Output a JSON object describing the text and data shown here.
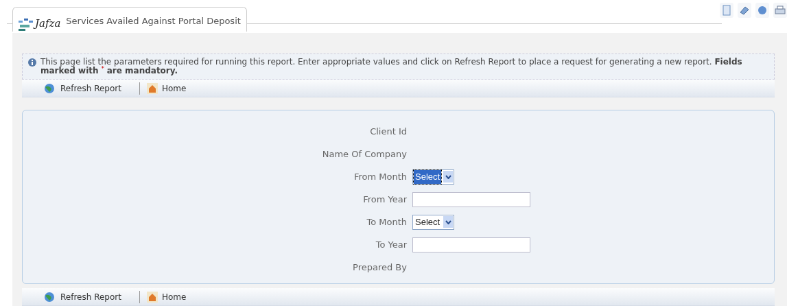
{
  "header": {
    "logo_text": "Jafza",
    "title": "Services Availed Against Portal Deposit"
  },
  "info": {
    "text": "This page list the parameters required for running this report. Enter appropriate values and click on Refresh Report to place a request for generating a new report. **Fields marked with** $^{*}$ **are mandatory.**"
  },
  "toolbar_top": [
    {
      "label": "Refresh Report",
      "kind": "refresh"
    },
    {
      "label": "Home",
      "kind": "home"
    }
  ],
  "form_fields": [
    {
      "label": "Client Id",
      "kind": "static"
    },
    {
      "label": "Name Of Company",
      "kind": "static"
    },
    {
      "label": "From Month",
      "kind": "select",
      "value": "Select",
      "selected": true
    },
    {
      "label": "From Year",
      "kind": "text"
    },
    {
      "label": "To Month",
      "kind": "select",
      "value": "Select",
      "selected": false
    },
    {
      "label": "To Year",
      "kind": "text"
    },
    {
      "label": "Prepared By",
      "kind": "static"
    }
  ],
  "toolbar_bottom": [
    {
      "label": "Refresh Report",
      "kind": "refresh"
    },
    {
      "label": "Home",
      "kind": "home"
    }
  ]
}
